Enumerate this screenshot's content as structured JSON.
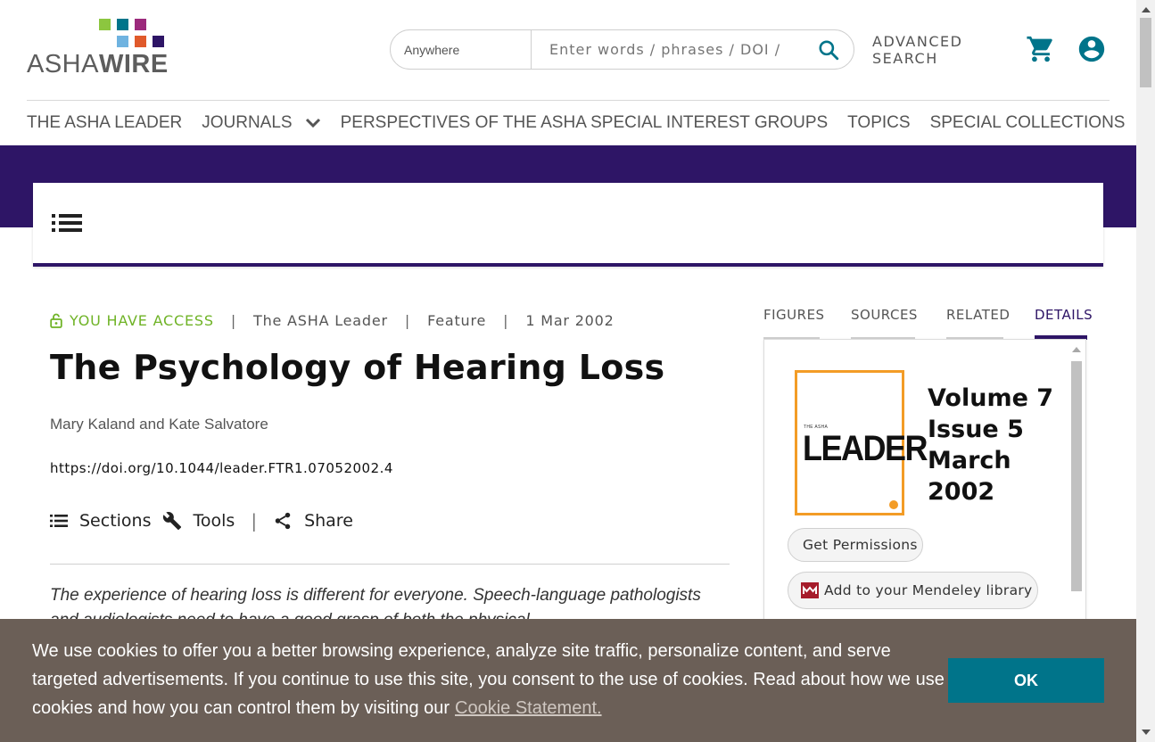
{
  "brand": {
    "logo_text_light": "ASHA",
    "logo_text_bold": "WIRE",
    "logo_colors": [
      "#8cc63f",
      "#00748a",
      "#9c2a7c",
      "#6fb3e0",
      "#e05a2b",
      "#2e1566"
    ]
  },
  "search": {
    "scope": "Anywhere",
    "placeholder": "Enter words / phrases / DOI / ISBN / keywords / authors / etc",
    "icon": "search-icon"
  },
  "header": {
    "advanced_line1": "ADVANCED",
    "advanced_line2": "SEARCH",
    "cart_icon": "cart-icon",
    "account_icon": "account-icon"
  },
  "nav": {
    "items": [
      "THE ASHA LEADER",
      "JOURNALS",
      "PERSPECTIVES OF THE ASHA SPECIAL INTEREST GROUPS",
      "TOPICS",
      "SPECIAL COLLECTIONS"
    ]
  },
  "article": {
    "access": "YOU HAVE ACCESS",
    "journal": "The ASHA Leader",
    "type": "Feature",
    "date": "1 Mar 2002",
    "title": "The Psychology of Hearing Loss",
    "author1": "Mary Kaland",
    "and": "and",
    "author2": "Kate Salvatore",
    "doi": "https://doi.org/10.1044/leader.FTR1.07052002.4",
    "tools": {
      "sections": "Sections",
      "tools": "Tools",
      "share": "Share"
    },
    "abstract": "The experience of hearing loss is different for everyone. Speech-language pathologists and audiologists need to have a good grasp of both the physical"
  },
  "sidebar": {
    "tabs": [
      "FIGURES",
      "SOURCES",
      "RELATED",
      "DETAILS"
    ],
    "active_tab": "DETAILS",
    "cover": {
      "small": "THE ASHA",
      "big": "LEADER",
      "border_color": "#f39c26"
    },
    "volume": "Volume 7",
    "issue": "Issue 5",
    "month": "March",
    "year": "2002",
    "permissions": "Get Permissions",
    "mendeley": "Add to your Mendeley library"
  },
  "cookie": {
    "message": "We use cookies to offer you a better browsing experience, analyze site traffic, personalize content, and serve targeted advertisements. If you continue to use this site, you consent to the use of cookies. Read about how we use cookies and how you can control them by visiting our",
    "link": "Cookie Statement.",
    "ok": "OK"
  },
  "colors": {
    "accent_purple": "#2e1566",
    "access_green": "#6fb326",
    "teal": "#00748a",
    "cookie_bg": "#6b5f57"
  }
}
